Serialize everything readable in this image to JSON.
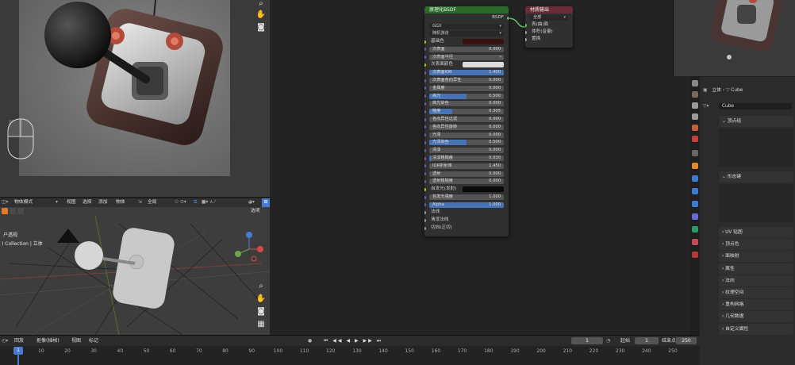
{
  "node_editor": {
    "bsdf_node": {
      "title": "原理化BSDF",
      "output_label": "BSDF",
      "distribution": "GGX",
      "subsurface_method": "随机游走",
      "rows": [
        {
          "label": "基础色",
          "type": "color",
          "color": "#3a1010"
        },
        {
          "label": "次表面",
          "value": "0.000",
          "fill": 0
        },
        {
          "label": "次表面半径",
          "type": "dropdown"
        },
        {
          "label": "次表面颜色",
          "type": "color",
          "color": "#dcdcdc"
        },
        {
          "label": "次表面IOR",
          "value": "1.400",
          "fill": 1
        },
        {
          "label": "次表面各向异性",
          "value": "0.000",
          "fill": 0
        },
        {
          "label": "金属度",
          "value": "0.000",
          "fill": 0
        },
        {
          "label": "高光",
          "value": "0.500",
          "fill": 0.5
        },
        {
          "label": "高光染色",
          "value": "0.000",
          "fill": 0
        },
        {
          "label": "糙度",
          "value": "0.305",
          "fill": 0.305
        },
        {
          "label": "各向异性过滤",
          "value": "0.000",
          "fill": 0
        },
        {
          "label": "各向异性旋转",
          "value": "0.000",
          "fill": 0
        },
        {
          "label": "光泽",
          "value": "0.000",
          "fill": 0
        },
        {
          "label": "光泽染色",
          "value": "0.500",
          "fill": 0.5
        },
        {
          "label": "清漆",
          "value": "0.000",
          "fill": 0
        },
        {
          "label": "清漆粗糙度",
          "value": "0.030",
          "fill": 0.03
        },
        {
          "label": "IOR折射率",
          "value": "1.450",
          "fill": 0
        },
        {
          "label": "透射",
          "value": "0.000",
          "fill": 0
        },
        {
          "label": "透射粗糙度",
          "value": "0.000",
          "fill": 0
        },
        {
          "label": "自发光(发射)",
          "type": "color",
          "color": "#0a0a0a"
        },
        {
          "label": "自发光强度",
          "value": "1.000",
          "fill": 0
        },
        {
          "label": "Alpha",
          "value": "1.000",
          "fill": 1
        },
        {
          "label": "法线",
          "type": "socket"
        },
        {
          "label": "清漆法线",
          "type": "socket"
        },
        {
          "label": "切向(正切)",
          "type": "socket"
        }
      ]
    },
    "output_node": {
      "title": "材质输出",
      "target": "全部",
      "inputs": [
        "表(曲)面",
        "体积(音量)",
        "置换"
      ]
    }
  },
  "viewport": {
    "mode": "物体模式",
    "menus": [
      "视图",
      "选择",
      "添加",
      "物体"
    ],
    "transform": "全局",
    "options_label": "选项",
    "overlay_text_1": "户透视",
    "overlay_text_2": ") Collection | 立体"
  },
  "properties": {
    "breadcrumb_scene": "立体",
    "breadcrumb_object": "Cube",
    "data_name": "Cube",
    "panels": [
      {
        "label": "顶点组",
        "expanded": true
      },
      {
        "label": "形态键",
        "expanded": true
      },
      {
        "label": "UV 贴图",
        "expanded": false
      },
      {
        "label": "顶点色",
        "expanded": false
      },
      {
        "label": "面映射",
        "expanded": false
      },
      {
        "label": "属性",
        "expanded": false
      },
      {
        "label": "法向",
        "expanded": false
      },
      {
        "label": "纹理空间",
        "expanded": false
      },
      {
        "label": "重构网格",
        "expanded": false
      },
      {
        "label": "几何数据",
        "expanded": false
      },
      {
        "label": "自定义属性",
        "expanded": false
      }
    ]
  },
  "timeline": {
    "menus": [
      "回放",
      "抠像(插帧)",
      "视图",
      "标记"
    ],
    "current_frame": "1",
    "start_label": "起始",
    "start_frame": "1",
    "end_label": "结束点",
    "end_frame": "250",
    "ruler_ticks": [
      "1",
      "10",
      "20",
      "30",
      "40",
      "50",
      "60",
      "70",
      "80",
      "90",
      "100",
      "110",
      "120",
      "130",
      "140",
      "150",
      "160",
      "170",
      "180",
      "190",
      "200",
      "210",
      "220",
      "230",
      "240",
      "250"
    ]
  },
  "colors": {
    "bsdf_header": "#2c6a2c",
    "output_header": "#6a2c37",
    "accent": "#4772b3"
  }
}
